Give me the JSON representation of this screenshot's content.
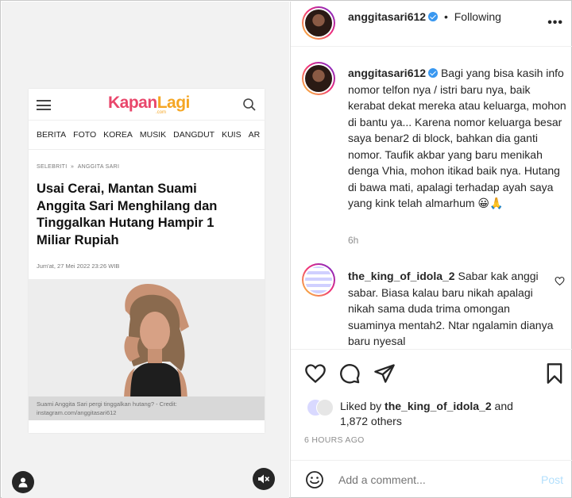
{
  "media": {
    "site_logo_part1": "Kapan",
    "site_logo_part2": "Lagi",
    "site_logo_sub": ".com",
    "nav": [
      "BERITA",
      "FOTO",
      "KOREA",
      "MUSIK",
      "DANGDUT",
      "KUIS",
      "AR"
    ],
    "breadcrumb_1": "SELEBRITI",
    "breadcrumb_sep": "»",
    "breadcrumb_2": "ANGGITA SARI",
    "title": "Usai Cerai, Mantan Suami Anggita Sari Menghilang dan Tinggalkan Hutang Hampir 1 Miliar Rupiah",
    "date": "Jum'at, 27 Mei 2022 23:26 WIB",
    "caption": "Suami Anggita Sari pergi tinggalkan hutang? - Credit: instagram.com/anggitasari612"
  },
  "header": {
    "username": "anggitasari612",
    "separator": "•",
    "follow_status": "Following"
  },
  "caption": {
    "username": "anggitasari612",
    "text": "Bagi yang bisa kasih info nomor telfon nya / istri baru nya, baik kerabat dekat mereka atau keluarga, mohon di bantu ya... Karena nomor keluarga besar saya benar2 di block, bahkan dia ganti nomor. Taufik akbar yang baru menikah denga Vhia, mohon itikad baik nya. Hutang di bawa mati, apalagi terhadap ayah saya yang kink telah almarhum 😀🙏",
    "time": "6h"
  },
  "comment": {
    "username": "the_king_of_idola_2",
    "text": "Sabar kak anggi sabar. Biasa kalau baru nikah apalagi nikah sama duda trima omongan suaminya mentah2. Ntar ngalamin dianya baru nyesal"
  },
  "likes": {
    "prefix": "Liked by",
    "user": "the_king_of_idola_2",
    "suffix": "and",
    "others": "1,872 others"
  },
  "posted_ago": "6 HOURS AGO",
  "add_comment": {
    "placeholder": "Add a comment...",
    "post_label": "Post"
  },
  "colors": {
    "verified": "#3897f0",
    "post_disabled": "#b2dffc",
    "logo_pink": "#e9466b",
    "logo_orange": "#f5a623"
  }
}
